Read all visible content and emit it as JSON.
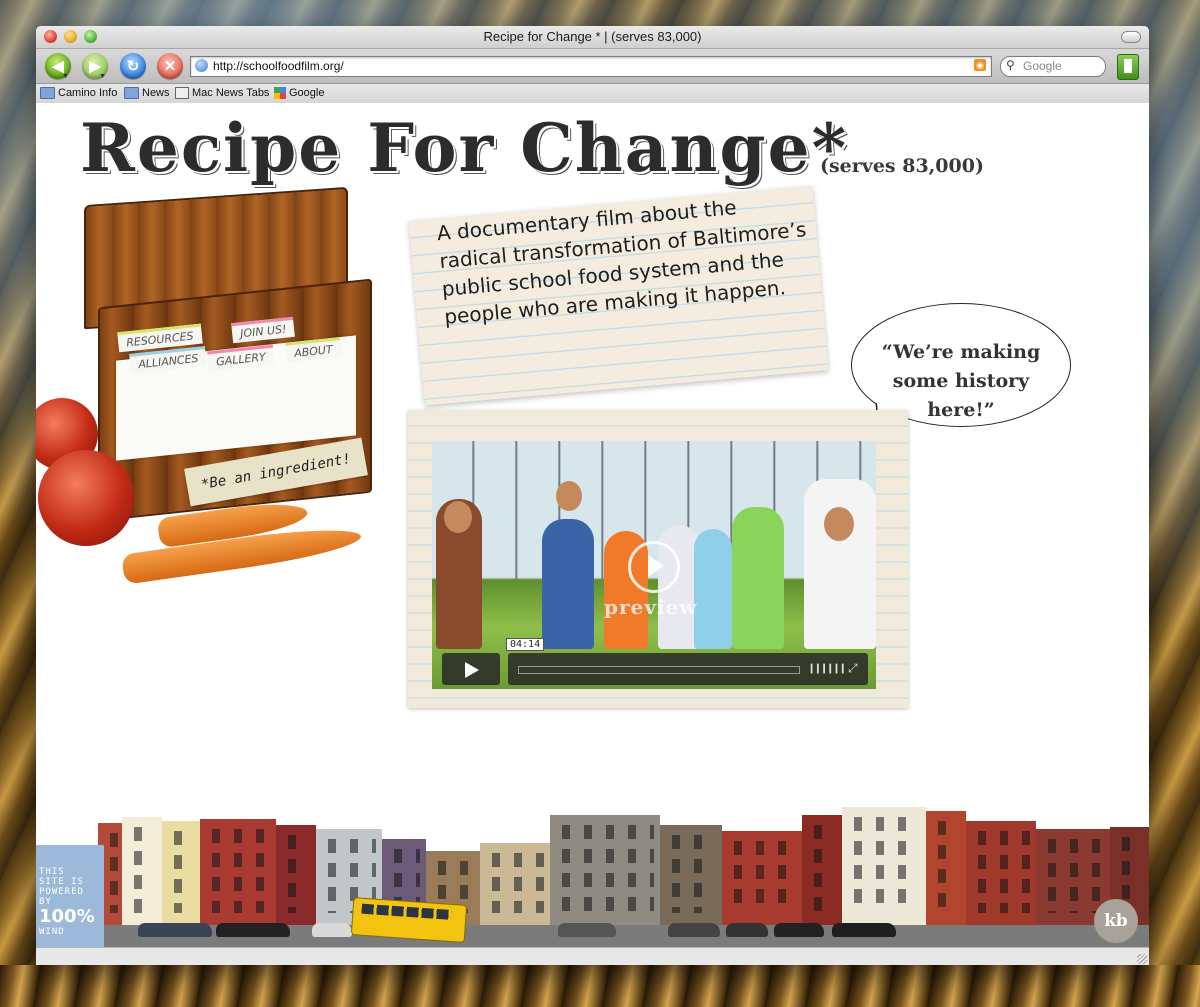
{
  "window": {
    "title": "Recipe for Change * | (serves 83,000)"
  },
  "toolbar": {
    "back_icon": "back-arrow-icon",
    "forward_icon": "forward-arrow-icon",
    "reload_icon": "reload-icon",
    "stop_icon": "stop-icon",
    "url": "http://schoolfoodfilm.org/",
    "search_placeholder": "Google"
  },
  "bookmarks": [
    {
      "label": "Camino Info",
      "icon": "folder-icon"
    },
    {
      "label": "News",
      "icon": "folder-icon"
    },
    {
      "label": "Mac News Tabs",
      "icon": "tabs-icon"
    },
    {
      "label": "Google",
      "icon": "google-icon"
    }
  ],
  "site": {
    "title": "Recipe For Change*",
    "serves": "(serves 83,000)",
    "tagline": "A documentary film about the radical transformation of Baltimore’s public school food system and the people who are making it happen.",
    "quote": "“We’re making some history here!”",
    "recipe_tabs": [
      "RESOURCES",
      "JOIN US!",
      "ALLIANCES",
      "GALLERY",
      "ABOUT"
    ],
    "box_label": "*Be an ingredient!"
  },
  "video": {
    "overlay_label": "preview",
    "timecode": "04:14",
    "progress": 0.0
  },
  "footer": {
    "wind_badge": [
      "THIS",
      "SITE IS",
      "POWERED",
      "BY"
    ],
    "wind_percent": "100%",
    "wind_word": "WIND",
    "logo": "kb"
  },
  "colors": {
    "accent_green": "#6aae1c",
    "paper": "#f3ecdf",
    "school_bus": "#f3c40f"
  }
}
